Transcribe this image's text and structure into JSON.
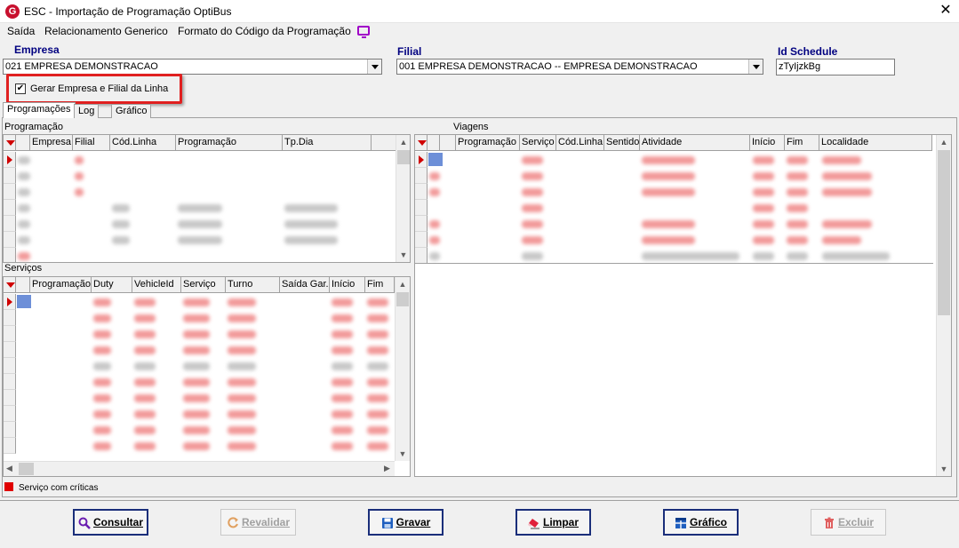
{
  "window": {
    "title": "ESC - Importação de Programação OptiBus"
  },
  "menu": [
    "Saída",
    "Relacionamento Generico",
    "Formato do Código da Programação"
  ],
  "fields": {
    "empresa_label": "Empresa",
    "empresa_value": "021 EMPRESA DEMONSTRACAO",
    "filial_label": "Filial",
    "filial_value": "001 EMPRESA DEMONSTRACAO -- EMPRESA DEMONSTRACAO",
    "schedule_label": "Id Schedule",
    "schedule_value": "zTyIjzkBg",
    "checkbox_label": "Gerar Empresa e Filial da Linha",
    "checkbox_checked": true
  },
  "tabs": [
    "Programações",
    "Log",
    "Gráfico"
  ],
  "programacao": {
    "label": "Programação",
    "columns": [
      "Empresa",
      "Filial",
      "Cód.Linha",
      "Programação",
      "Tp.Dia"
    ]
  },
  "viagens": {
    "label": "Viagens",
    "columns": [
      "Programação",
      "Serviço",
      "Cód.Linha",
      "Sentido",
      "Atividade",
      "Início",
      "Fim",
      "Localidade"
    ]
  },
  "servicos": {
    "label": "Serviços",
    "columns": [
      "Programação",
      "Duty",
      "VehicleId",
      "Serviço",
      "Turno",
      "Saída Gar.",
      "Início",
      "Fim"
    ]
  },
  "status": {
    "legend": "Serviço com críticas"
  },
  "buttons": {
    "consultar": "Consultar",
    "revalidar": "Revalidar",
    "gravar": "Gravar",
    "limpar": "Limpar",
    "grafico": "Gráfico",
    "excluir": "Excluir"
  },
  "colors": {
    "accent": "#1a2e7a",
    "critical": "#e00000",
    "highlight": "#e02020"
  }
}
